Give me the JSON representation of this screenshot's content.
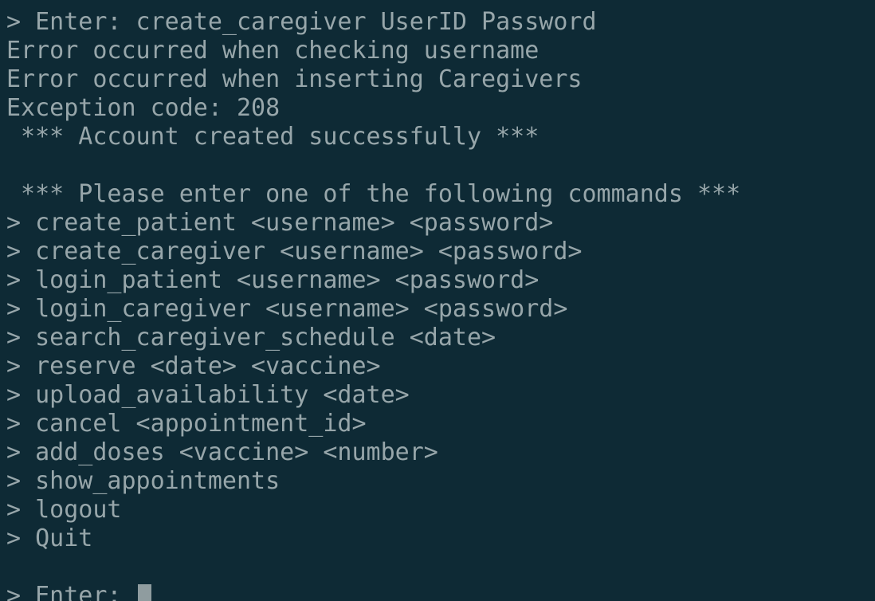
{
  "terminal": {
    "lines": [
      "> Enter: create_caregiver UserID Password",
      "Error occurred when checking username",
      "Error occurred when inserting Caregivers",
      "Exception code: 208",
      " *** Account created successfully ***",
      "",
      " *** Please enter one of the following commands ***",
      "> create_patient <username> <password>",
      "> create_caregiver <username> <password>",
      "> login_patient <username> <password>",
      "> login_caregiver <username> <password>",
      "> search_caregiver_schedule <date>",
      "> reserve <date> <vaccine>",
      "> upload_availability <date>",
      "> cancel <appointment_id>",
      "> add_doses <vaccine> <number>",
      "> show_appointments",
      "> logout",
      "> Quit",
      ""
    ],
    "prompt": "> Enter: "
  },
  "colors": {
    "background": "#0e2a35",
    "text": "#97a6aa",
    "cursor": "#8f9c9f"
  }
}
